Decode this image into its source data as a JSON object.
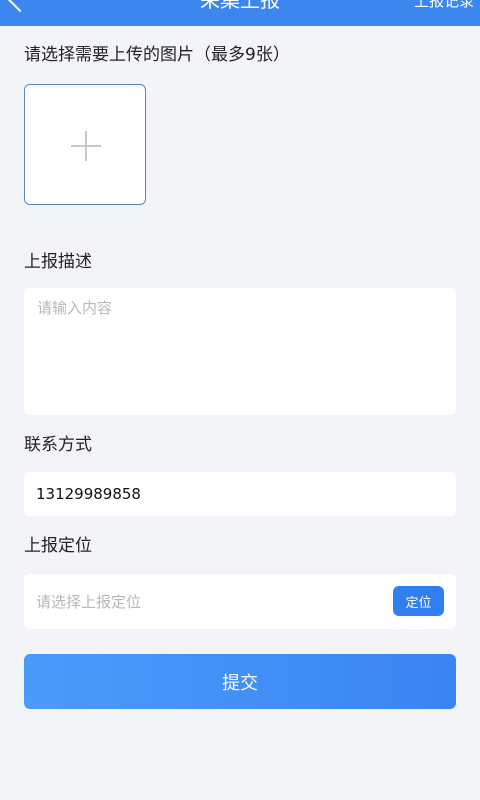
{
  "header": {
    "title": "采集上报",
    "record_label": "上报记录",
    "background": "#3c86f0"
  },
  "upload": {
    "label": "请选择需要上传的图片（最多9张）",
    "add_icon": "plus-icon"
  },
  "description": {
    "label": "上报描述",
    "placeholder": "请输入内容",
    "value": ""
  },
  "contact": {
    "label": "联系方式",
    "value": "13129989858"
  },
  "location": {
    "label": "上报定位",
    "placeholder": "请选择上报定位",
    "button_label": "定位"
  },
  "submit": {
    "label": "提交",
    "color": "#3a84f2"
  }
}
